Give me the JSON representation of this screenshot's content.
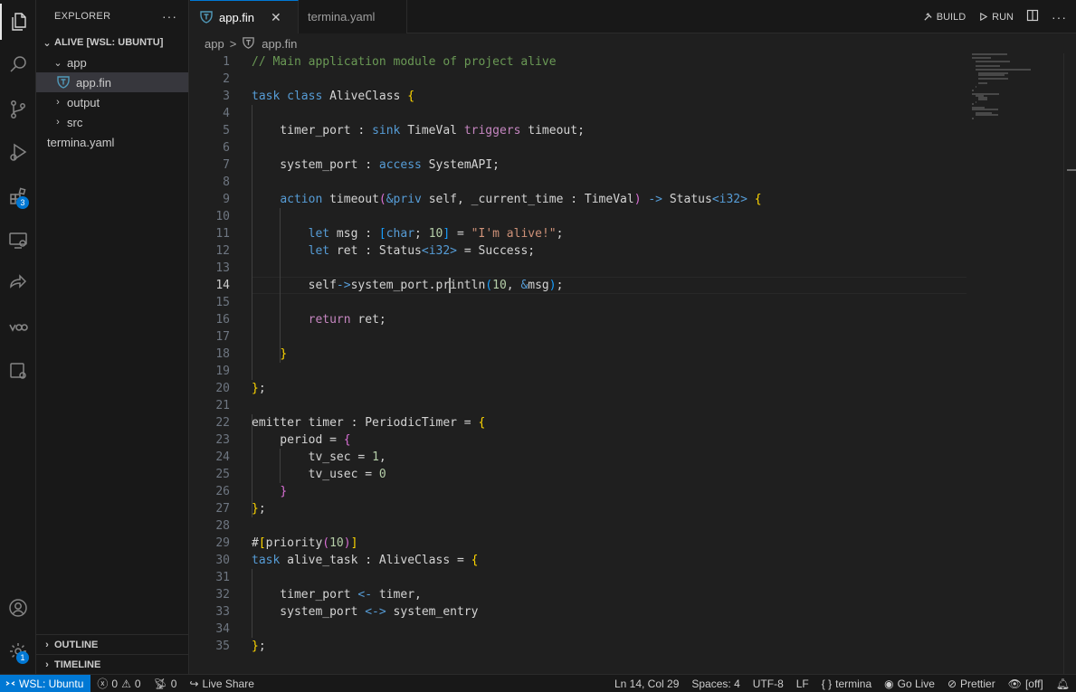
{
  "activity_bar": {
    "extensions_badge": "3",
    "settings_badge": "1"
  },
  "sidebar": {
    "title": "EXPLORER",
    "more": "···",
    "workspace": "ALIVE [WSL: UBUNTU]",
    "tree": [
      {
        "label": "app",
        "kind": "folder",
        "expanded": true
      },
      {
        "label": "app.fin",
        "kind": "file",
        "selected": true
      },
      {
        "label": "output",
        "kind": "folder",
        "expanded": false
      },
      {
        "label": "src",
        "kind": "folder",
        "expanded": false
      },
      {
        "label": "termina.yaml",
        "kind": "file"
      }
    ],
    "outline": "OUTLINE",
    "timeline": "TIMELINE"
  },
  "tabs": [
    {
      "label": "app.fin",
      "active": true,
      "close": "✕"
    },
    {
      "label": "termina.yaml",
      "active": false
    }
  ],
  "toolbar": {
    "build": "BUILD",
    "run": "RUN",
    "more": "···"
  },
  "breadcrumb": {
    "folder": "app",
    "separator": ">",
    "file": "app.fin"
  },
  "editor": {
    "current_line": 14,
    "lines": [
      [
        [
          "cm",
          "// Main application module of project alive"
        ]
      ],
      [],
      [
        [
          "kw",
          "task"
        ],
        [
          "id",
          " "
        ],
        [
          "kw",
          "class"
        ],
        [
          "id",
          " AliveClass "
        ],
        [
          "pb",
          "{"
        ]
      ],
      [],
      [
        [
          "id",
          "    timer_port "
        ],
        [
          "op",
          ":"
        ],
        [
          "id",
          " "
        ],
        [
          "kw",
          "sink"
        ],
        [
          "id",
          " TimeVal "
        ],
        [
          "ctl",
          "triggers"
        ],
        [
          "id",
          " timeout;"
        ]
      ],
      [],
      [
        [
          "id",
          "    system_port "
        ],
        [
          "op",
          ":"
        ],
        [
          "id",
          " "
        ],
        [
          "kw",
          "access"
        ],
        [
          "id",
          " SystemAPI;"
        ]
      ],
      [],
      [
        [
          "id",
          "    "
        ],
        [
          "kw",
          "action"
        ],
        [
          "id",
          " timeout"
        ],
        [
          "pp",
          "("
        ],
        [
          "kw",
          "&priv"
        ],
        [
          "id",
          " self, _current_time "
        ],
        [
          "op",
          ":"
        ],
        [
          "id",
          " TimeVal"
        ],
        [
          "pp",
          ")"
        ],
        [
          "id",
          " "
        ],
        [
          "kw",
          "->"
        ],
        [
          "id",
          " Status"
        ],
        [
          "kw",
          "<i32>"
        ],
        [
          "id",
          " "
        ],
        [
          "pb",
          "{"
        ]
      ],
      [],
      [
        [
          "id",
          "        "
        ],
        [
          "kw",
          "let"
        ],
        [
          "id",
          " msg "
        ],
        [
          "op",
          ":"
        ],
        [
          "id",
          " "
        ],
        [
          "bl",
          "["
        ],
        [
          "kw",
          "char"
        ],
        [
          "id",
          "; "
        ],
        [
          "nu",
          "10"
        ],
        [
          "bl",
          "]"
        ],
        [
          "id",
          " = "
        ],
        [
          "st",
          "\"I'm alive!\""
        ],
        [
          "id",
          ";"
        ]
      ],
      [
        [
          "id",
          "        "
        ],
        [
          "kw",
          "let"
        ],
        [
          "id",
          " ret "
        ],
        [
          "op",
          ":"
        ],
        [
          "id",
          " Status"
        ],
        [
          "kw",
          "<i32>"
        ],
        [
          "id",
          " = Success;"
        ]
      ],
      [],
      [
        [
          "id",
          "        self"
        ],
        [
          "kw",
          "->"
        ],
        [
          "id",
          "system_port.println"
        ],
        [
          "bl",
          "("
        ],
        [
          "nu",
          "10"
        ],
        [
          "id",
          ", "
        ],
        [
          "kw",
          "&"
        ],
        [
          "id",
          "msg"
        ],
        [
          "bl",
          ")"
        ],
        [
          "id",
          ";"
        ]
      ],
      [],
      [
        [
          "id",
          "        "
        ],
        [
          "ctl",
          "return"
        ],
        [
          "id",
          " ret;"
        ]
      ],
      [],
      [
        [
          "id",
          "    "
        ],
        [
          "pb",
          "}"
        ]
      ],
      [],
      [
        [
          "pb",
          "}"
        ],
        [
          "id",
          ";"
        ]
      ],
      [],
      [
        [
          "id",
          "emitter timer "
        ],
        [
          "op",
          ":"
        ],
        [
          "id",
          " PeriodicTimer = "
        ],
        [
          "pb",
          "{"
        ]
      ],
      [
        [
          "id",
          "    period = "
        ],
        [
          "pp",
          "{"
        ]
      ],
      [
        [
          "id",
          "        tv_sec = "
        ],
        [
          "nu",
          "1"
        ],
        [
          "id",
          ","
        ]
      ],
      [
        [
          "id",
          "        tv_usec = "
        ],
        [
          "nu",
          "0"
        ]
      ],
      [
        [
          "id",
          "    "
        ],
        [
          "pp",
          "}"
        ]
      ],
      [
        [
          "pb",
          "}"
        ],
        [
          "id",
          ";"
        ]
      ],
      [],
      [
        [
          "id",
          "#"
        ],
        [
          "pb",
          "["
        ],
        [
          "id",
          "priority"
        ],
        [
          "pp",
          "("
        ],
        [
          "nu",
          "10"
        ],
        [
          "pp",
          ")"
        ],
        [
          "pb",
          "]"
        ]
      ],
      [
        [
          "kw",
          "task"
        ],
        [
          "id",
          " alive_task "
        ],
        [
          "op",
          ":"
        ],
        [
          "id",
          " AliveClass = "
        ],
        [
          "pb",
          "{"
        ]
      ],
      [],
      [
        [
          "id",
          "    timer_port "
        ],
        [
          "kw",
          "<-"
        ],
        [
          "id",
          " timer,"
        ]
      ],
      [
        [
          "id",
          "    system_port "
        ],
        [
          "kw",
          "<->"
        ],
        [
          "id",
          " system_entry"
        ]
      ],
      [],
      [
        [
          "pb",
          "}"
        ],
        [
          "id",
          ";"
        ]
      ]
    ]
  },
  "statusbar": {
    "remote": "WSL: Ubuntu",
    "errors": "0",
    "warnings": "0",
    "ports": "0",
    "live_share": "Live Share",
    "position": "Ln 14, Col 29",
    "spaces": "Spaces: 4",
    "encoding": "UTF-8",
    "eol": "LF",
    "language": "termina",
    "go_live": "Go Live",
    "prettier": "Prettier",
    "off": "[off]"
  }
}
